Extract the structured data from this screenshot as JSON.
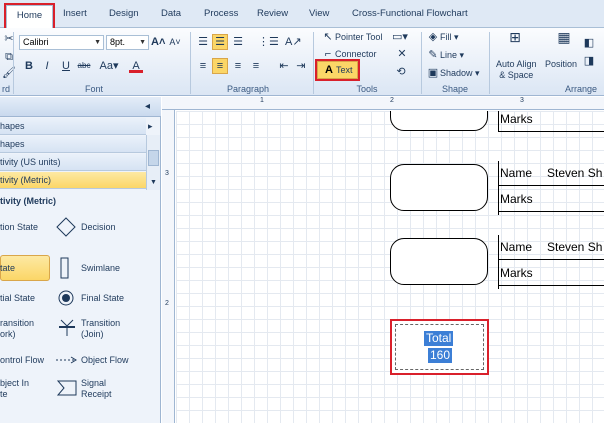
{
  "tabs": [
    "Home",
    "Insert",
    "Design",
    "Data",
    "Process",
    "Review",
    "View",
    "Cross-Functional Flowchart"
  ],
  "ribbon": {
    "font": {
      "family": "Calibri",
      "size": "8pt.",
      "label": "Font"
    },
    "paragraph_label": "Paragraph",
    "tools": {
      "pointer": "Pointer Tool",
      "connector": "Connector",
      "text": "Text",
      "label": "Tools"
    },
    "shape": {
      "fill": "Fill",
      "line": "Line",
      "shadow": "Shadow",
      "label": "Shape"
    },
    "arrange": {
      "auto_align": "Auto Align",
      "auto_align2": "& Space",
      "position": "Position",
      "label": "Arrange"
    },
    "clipboard_label": "rd"
  },
  "panel": {
    "rows": [
      "hapes",
      "hapes",
      "tivity (US units)",
      "tivity (Metric)"
    ],
    "stencil_title": "tivity (Metric)",
    "shapes": [
      {
        "label": "tion State"
      },
      {
        "label": "Decision"
      },
      {
        "label": "tate"
      },
      {
        "label": "Swimlane"
      },
      {
        "label": "tial State"
      },
      {
        "label": "Final State"
      },
      {
        "label": "ransition"
      },
      {
        "label": "ork)"
      },
      {
        "label": "Transition"
      },
      {
        "label": "(Join)"
      },
      {
        "label": "ontrol Flow"
      },
      {
        "label": "Object Flow"
      },
      {
        "label": "bject In"
      },
      {
        "label": "te"
      },
      {
        "label": "Signal"
      },
      {
        "label": "Receipt"
      }
    ]
  },
  "ruler": {
    "top": [
      "1",
      "2",
      "3"
    ],
    "left": [
      "3",
      "2"
    ]
  },
  "canvas": {
    "row1": {
      "marks": "Marks"
    },
    "row2": {
      "name": "Name",
      "student": "Steven Sh",
      "marks": "Marks"
    },
    "row3": {
      "name": "Name",
      "student": "Steven Sh",
      "marks": "Marks"
    },
    "total": {
      "line1": "Total",
      "line2": "160"
    }
  },
  "colors": {
    "highlight": "#d9202b",
    "selection": "#3c7fd6",
    "active_row": "#fbd667"
  }
}
